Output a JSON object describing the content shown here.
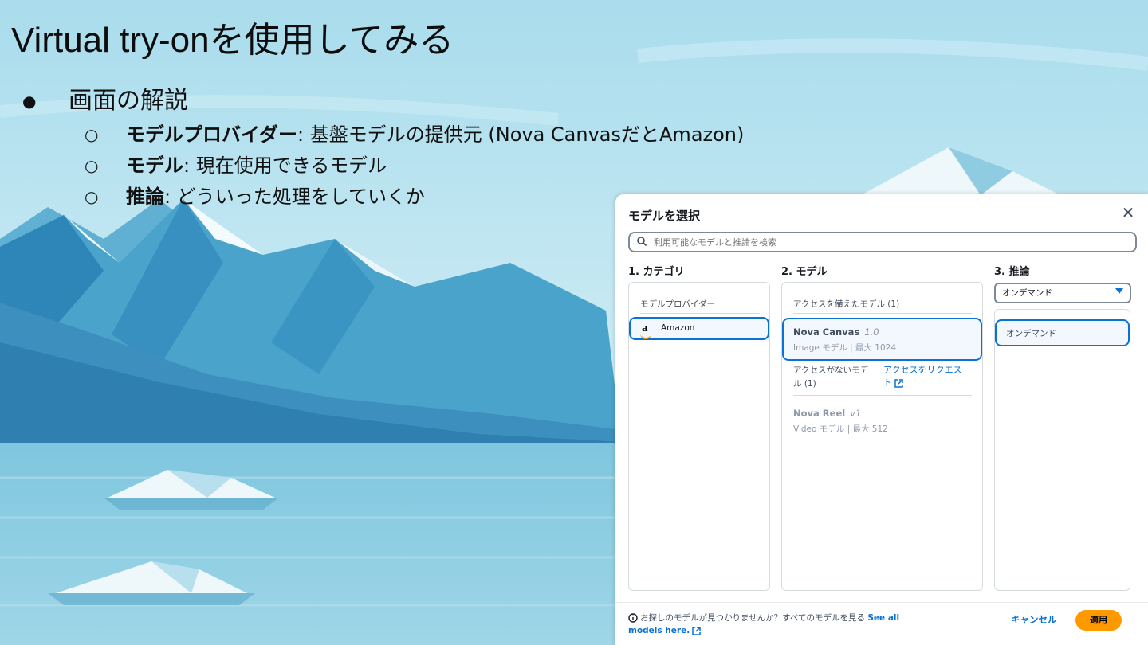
{
  "slide": {
    "title": "Virtual try-onを使用してみる",
    "bullet": "画面の解説",
    "sub_bullets": [
      {
        "term": "モデルプロバイダー",
        "rest": ": 基盤モデルの提供元  (Nova CanvasだとAmazon)"
      },
      {
        "term": "モデル",
        "rest": ": 現在使用できるモデル"
      },
      {
        "term": "推論",
        "rest": ": どういった処理をしていくか"
      }
    ]
  },
  "dialog": {
    "title": "モデルを選択",
    "search_placeholder": "利用可能なモデルと推論を検索",
    "col1": {
      "heading": "1. カテゴリ",
      "group_label": "モデルプロバイダー",
      "providers": [
        {
          "name": "Amazon",
          "logo": "amazon-logo-icon"
        }
      ]
    },
    "col2": {
      "heading": "2. モデル",
      "access_group": "アクセスを備えたモデル (1)",
      "models_access": [
        {
          "name": "Nova Canvas",
          "version": "1.0",
          "desc": "Image モデル | 最大 1024"
        }
      ],
      "no_access_group_line1": "アクセスがないモデ",
      "no_access_group_line2": "ル (1)",
      "request_link_line1": "アクセスをリクエス",
      "request_link_line2": "ト",
      "models_no_access": [
        {
          "name": "Nova Reel",
          "version": "v1",
          "desc": "Video モデル | 最大 512"
        }
      ]
    },
    "col3": {
      "heading": "3. 推論",
      "select_value": "オンデマンド",
      "options": [
        "オンデマンド"
      ]
    },
    "footer": {
      "info_text": "お探しのモデルが見つかりませんか？すべてのモデルを見る",
      "link_part1": "See all",
      "link_part2": "models here.",
      "cancel_label": "キャンセル",
      "apply_label": "適用"
    }
  }
}
